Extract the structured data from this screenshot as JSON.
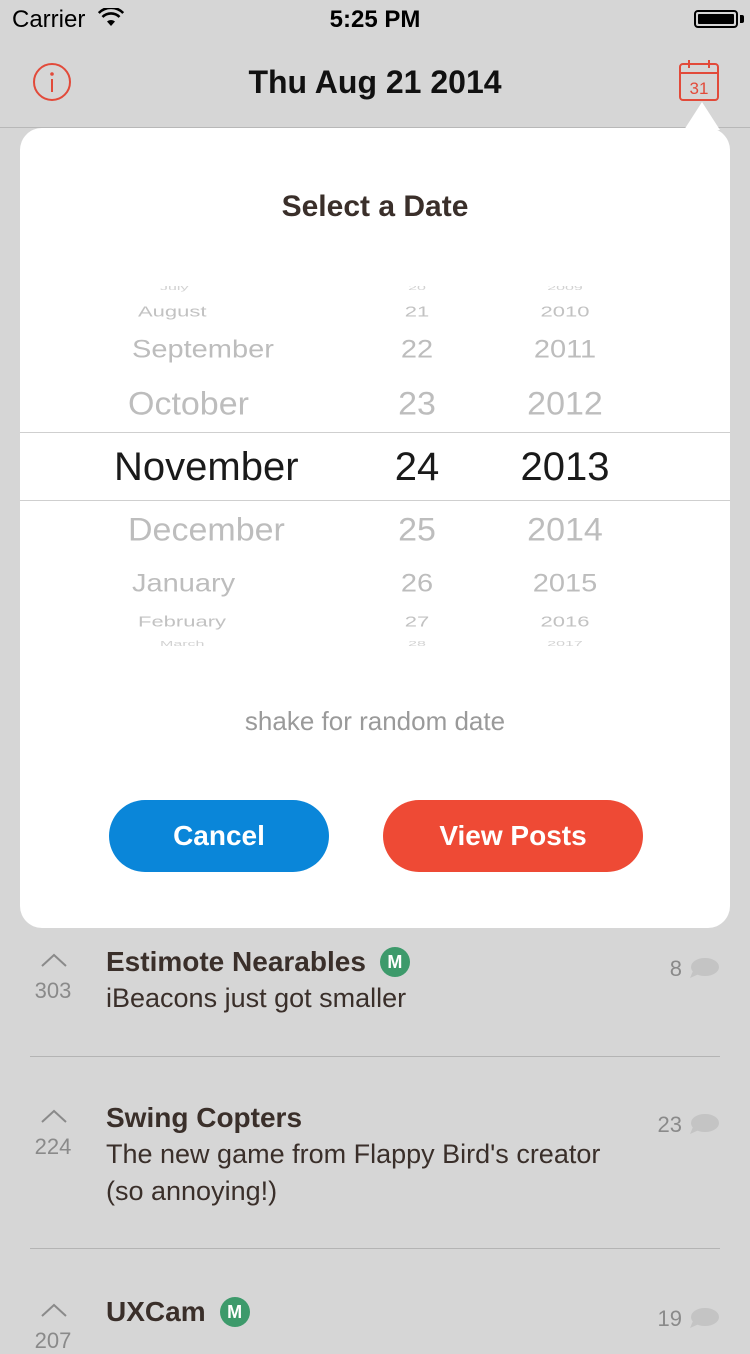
{
  "status_bar": {
    "carrier": "Carrier",
    "time": "5:25 PM"
  },
  "nav": {
    "title": "Thu Aug 21 2014",
    "calendar_day": "31"
  },
  "date_picker": {
    "heading": "Select a Date",
    "months": [
      "July",
      "August",
      "September",
      "October",
      "November",
      "December",
      "January",
      "February",
      "March"
    ],
    "days": [
      "20",
      "21",
      "22",
      "23",
      "24",
      "25",
      "26",
      "27",
      "28"
    ],
    "years": [
      "2009",
      "2010",
      "2011",
      "2012",
      "2013",
      "2014",
      "2015",
      "2016",
      "2017"
    ],
    "selected": {
      "month": "November",
      "day": "24",
      "year": "2013"
    },
    "hint": "shake for random date",
    "cancel_label": "Cancel",
    "view_label": "View Posts"
  },
  "posts": [
    {
      "votes": "303",
      "name": "Estimote Nearables",
      "badge": "M",
      "tagline": "iBeacons just got smaller",
      "comments": "8"
    },
    {
      "votes": "224",
      "name": "Swing Copters",
      "badge": "",
      "tagline": "The new game from Flappy Bird's creator (so annoying!)",
      "comments": "23"
    },
    {
      "votes": "207",
      "name": "UXCam",
      "badge": "M",
      "tagline": "",
      "comments": "19"
    }
  ],
  "colors": {
    "accent": "#e24a3a",
    "cancel": "#0a86d9",
    "view_posts": "#ee4a35",
    "badge": "#3d9a6b"
  }
}
